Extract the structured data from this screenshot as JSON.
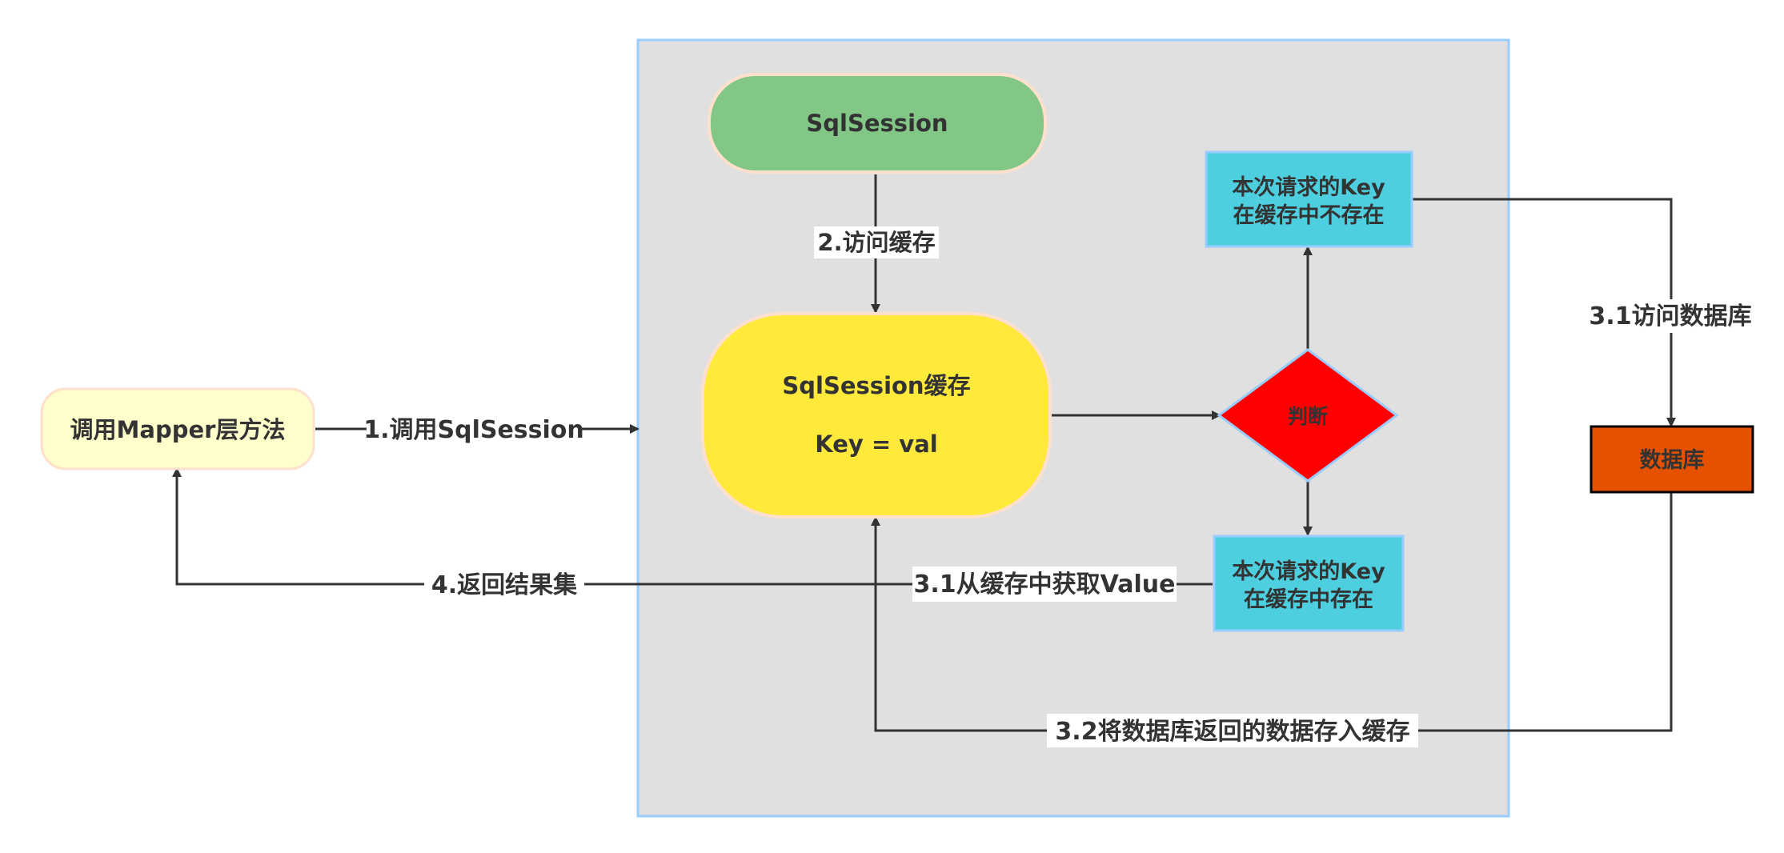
{
  "nodes": {
    "mapper": {
      "label": "调用Mapper层方法"
    },
    "sqlsession": {
      "label": "SqlSession"
    },
    "cache": {
      "line1": "SqlSession缓存",
      "line2": "Key = val"
    },
    "judge": {
      "label": "判断"
    },
    "key_missing": {
      "line1": "本次请求的Key",
      "line2": "在缓存中不存在"
    },
    "key_exists": {
      "line1": "本次请求的Key",
      "line2": "在缓存中存在"
    },
    "database": {
      "label": "数据库"
    }
  },
  "edges": {
    "call_sqlsession": "1.调用SqlSession",
    "access_cache": "2.访问缓存",
    "access_db": "3.1访问数据库",
    "get_value": "3.1从缓存中获取Value",
    "store_cache": "3.2将数据库返回的数据存入缓存",
    "return_result": "4.返回结果集"
  },
  "colors": {
    "container_fill": "#e0e0e0",
    "container_border": "#99ccff",
    "mapper_fill": "#ffffcc",
    "mapper_border": "#ffe0cc",
    "sqlsession_fill": "#82c785",
    "cache_fill": "#ffe93b",
    "judge_fill": "#ff0000",
    "key_box_fill": "#4dcfe0",
    "database_fill": "#e65100",
    "edge": "#333333"
  }
}
